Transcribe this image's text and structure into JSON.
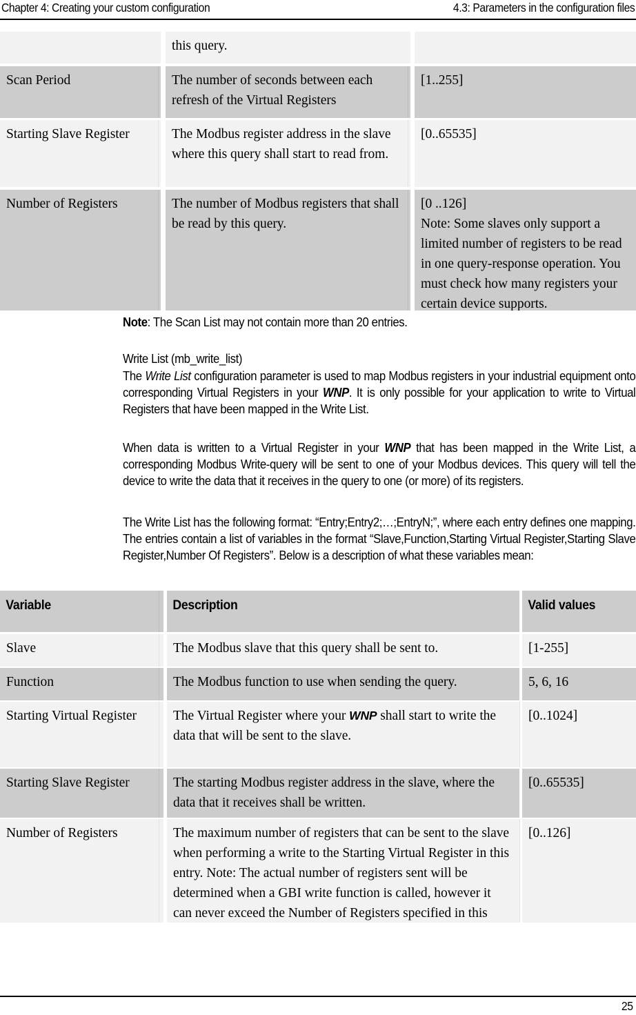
{
  "header": {
    "left": "Chapter 4: Creating your custom configuration",
    "right": "4.3: Parameters in the configuration files"
  },
  "footer": {
    "page_number": "25"
  },
  "colors": {
    "row_light": "#f2f2f2",
    "row_shaded": "#cccccc",
    "rule": "#000000"
  },
  "scan_list_table": {
    "rows": [
      {
        "variable": "",
        "description": "this query.",
        "valid_values": "",
        "shaded": false
      },
      {
        "variable": "Scan Period",
        "description": "The number of seconds between each refresh of the Virtual Registers",
        "valid_values": "[1..255]",
        "shaded": true
      },
      {
        "variable": "Starting Slave Register",
        "description": "The Modbus register address in the slave where this query shall start to read from.",
        "valid_values": "[0..65535]",
        "shaded": false
      },
      {
        "variable": "Number of Registers",
        "description": "The number of Modbus registers that shall be read by this query.",
        "valid_values": "[0 ..126]\nNote: Some slaves only support a limited number of registers to be read in one query-response operation. You must check how many registers your certain device supports.",
        "shaded": true
      }
    ]
  },
  "note": {
    "label": "Note",
    "text": ": The Scan List may not contain more than 20 entries."
  },
  "write_list_section": {
    "heading": "Write List (mb_write_list)",
    "paragraph_1": {
      "part_1": "The ",
      "italic_1": "Write List",
      "part_2": " configuration parameter is used to map Modbus registers in your industrial equipment onto corresponding Virtual Registers in your ",
      "bold_italic_1": "WNP",
      "part_3": ". It is only possible for your application to write to Virtual Registers that have been mapped in the Write List."
    },
    "paragraph_2": {
      "part_1": "When data is written to a Virtual Register in your ",
      "bold_italic_1": "WNP",
      "part_2": " that has been mapped in the Write List, a corresponding Modbus Write-query will be sent to one of your Modbus devices. This query will tell the device to write the data that it receives in the query to one (or more) of its registers."
    },
    "paragraph_3": "The Write List has the following format: “Entry;Entry2;…;EntryN;”, where each entry defines one mapping. The entries contain a list of variables in the format “Slave,Function,Starting Virtual Register,Starting Slave Register,Number Of Registers”. Below is a description of what these variables mean:"
  },
  "write_list_table": {
    "headers": {
      "variable": "Variable",
      "description": "Description",
      "valid_values": "Valid values"
    },
    "rows": [
      {
        "variable": "Slave",
        "description": "The Modbus slave that this query shall be sent to.",
        "valid_values": "[1-255]",
        "shaded": false
      },
      {
        "variable": "Function",
        "description": "The Modbus function to use when sending the query.",
        "valid_values": "5, 6, 16",
        "shaded": true
      },
      {
        "variable": "Starting Virtual Register",
        "description_part_1": "The Virtual Register where your ",
        "description_bold_italic": "WNP",
        "description_part_2": " shall start to write the data that will be sent to the slave.",
        "valid_values": "[0..1024]",
        "shaded": false
      },
      {
        "variable": "Starting Slave Register",
        "description": "The starting Modbus register address in the slave, where the data that it receives shall be written.",
        "valid_values": "[0..65535]",
        "shaded": true
      },
      {
        "variable": "Number of Registers",
        "description": "The maximum number of registers that can be sent to the slave when performing a write to the Starting Virtual Register in this entry. Note: The actual number of registers sent will be determined when a GBI write function is called, however it can never exceed the Number of Registers specified in this entry.",
        "valid_values": "[0..126]",
        "shaded": false
      }
    ]
  }
}
